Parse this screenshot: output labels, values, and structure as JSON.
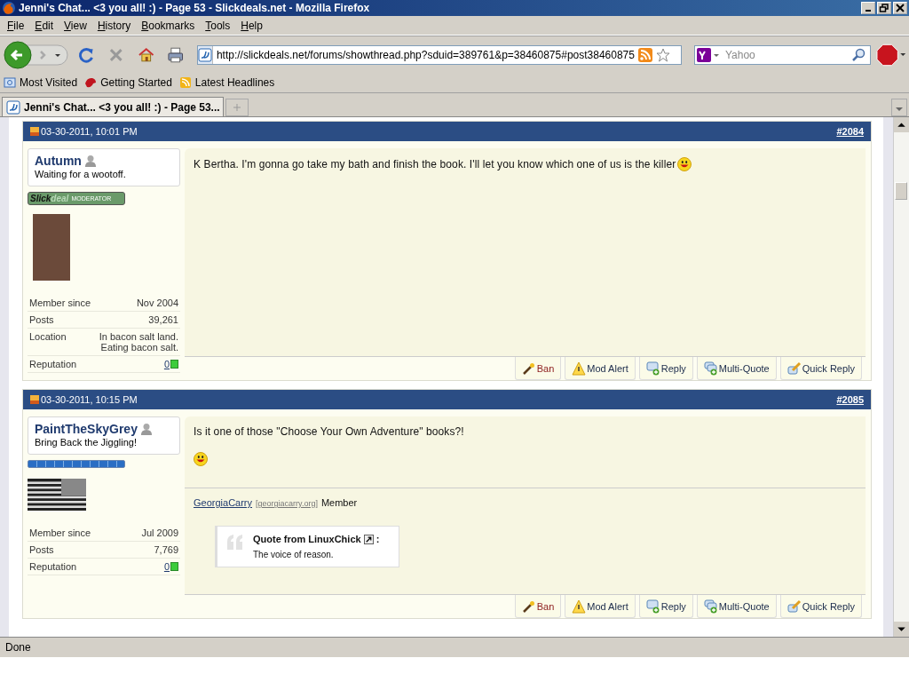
{
  "window": {
    "title": "Jenni's Chat... <3 you all! :) - Page 53 - Slickdeals.net - Mozilla Firefox"
  },
  "menu": [
    {
      "label": "File"
    },
    {
      "label": "Edit"
    },
    {
      "label": "View"
    },
    {
      "label": "History"
    },
    {
      "label": "Bookmarks"
    },
    {
      "label": "Tools"
    },
    {
      "label": "Help"
    }
  ],
  "toolbar": {
    "url": "http://slickdeals.net/forums/showthread.php?sduid=389761&p=38460875#post38460875",
    "search_placeholder": "Yahoo"
  },
  "bookmarks": [
    {
      "label": "Most Visited",
      "kind": "folder"
    },
    {
      "label": "Getting Started",
      "kind": "bird"
    },
    {
      "label": "Latest Headlines",
      "kind": "feed"
    }
  ],
  "tabs": [
    {
      "label": "Jenni's Chat... <3 you all! :) - Page 53...",
      "selected": true
    }
  ],
  "posts": [
    {
      "date": "03-30-2011, 10:01 PM",
      "number": "#2084",
      "user": {
        "name": "Autumn",
        "title": "Waiting for a wootoff.",
        "badge": {
          "kind": "moderator",
          "logo_1": "Slick",
          "logo_2": "deal",
          "label": "MODERATOR"
        },
        "avatar": {
          "kind": "photo"
        },
        "stats": [
          {
            "label": "Member since",
            "value": "Nov 2004"
          },
          {
            "label": "Posts",
            "value": "39,261"
          },
          {
            "label": "Location",
            "value": "In bacon salt land. Eating bacon salt."
          }
        ],
        "reputation_label": "Reputation",
        "reputation": "0"
      },
      "message": [
        {
          "kind": "text",
          "text": "K Bertha. I'm gonna go take my bath and finish the book. I'll let you know which one of us is the killer"
        }
      ],
      "actions": [
        {
          "label": "Ban",
          "kind": "ban"
        },
        {
          "label": "Mod Alert",
          "kind": "alert"
        },
        {
          "label": "Reply",
          "kind": "reply"
        },
        {
          "label": "Multi-Quote",
          "kind": "multi"
        },
        {
          "label": "Quick Reply",
          "kind": "quick"
        }
      ]
    },
    {
      "date": "03-30-2011, 10:15 PM",
      "number": "#2085",
      "user": {
        "name": "PaintTheSkyGrey",
        "title": "Bring Back the Jiggling!",
        "badge": {
          "kind": "bar"
        },
        "avatar": {
          "kind": "flag"
        },
        "stats": [
          {
            "label": "Member since",
            "value": "Jul 2009"
          },
          {
            "label": "Posts",
            "value": "7,769"
          }
        ],
        "reputation_label": "Reputation",
        "reputation": "0"
      },
      "message": [
        {
          "kind": "text",
          "text": "Is it one of those \"Choose Your Own Adventure\" books?!"
        },
        {
          "kind": "smiley"
        }
      ],
      "signature": {
        "link": "GeorgiaCarry",
        "domain": "[georgiacarry.org]",
        "role": "Member",
        "quote_title": "Quote from LinuxChick",
        "quote_colon": ":",
        "quote_text": "The voice of reason."
      },
      "actions": [
        {
          "label": "Ban",
          "kind": "ban"
        },
        {
          "label": "Mod Alert",
          "kind": "alert"
        },
        {
          "label": "Reply",
          "kind": "reply"
        },
        {
          "label": "Multi-Quote",
          "kind": "multi"
        },
        {
          "label": "Quick Reply",
          "kind": "quick"
        }
      ]
    }
  ],
  "status_bar": "Done"
}
